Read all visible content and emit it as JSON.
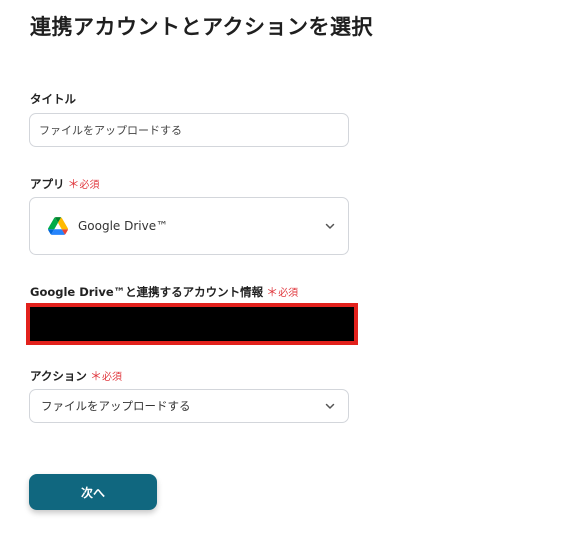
{
  "page": {
    "title": "連携アカウントとアクションを選択"
  },
  "form": {
    "title_field": {
      "label": "タイトル",
      "value": "ファイルをアップロードする"
    },
    "app_field": {
      "label": "アプリ",
      "required_text": "必須",
      "value": "Google Drive™",
      "icon": "google-drive-icon"
    },
    "account_field": {
      "label": "Google Drive™と連携するアカウント情報",
      "required_text": "必須"
    },
    "action_field": {
      "label": "アクション",
      "required_text": "必須",
      "value": "ファイルをアップロードする"
    },
    "next_button_label": "次へ"
  },
  "colors": {
    "primary_button": "#10677f",
    "required": "#e0383e",
    "redaction_border": "#e2211c"
  }
}
